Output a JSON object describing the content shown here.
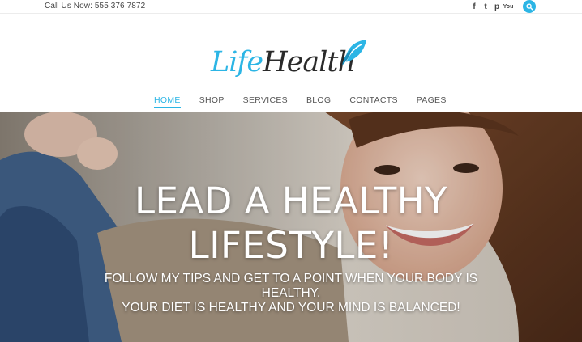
{
  "topbar": {
    "phone": "Call Us Now: 555 376 7872",
    "social": [
      {
        "name": "facebook-icon",
        "glyph": "f"
      },
      {
        "name": "twitter-icon",
        "glyph": "t"
      },
      {
        "name": "pinterest-icon",
        "glyph": "p"
      },
      {
        "name": "youtube-icon",
        "glyph": "You"
      }
    ],
    "search_icon": "search-icon"
  },
  "logo": {
    "part1": "Life",
    "part2": "Health",
    "icon": "butterfly-leaf-icon",
    "colors": {
      "accent": "#2cb5e5",
      "dark": "#2a2a2a"
    }
  },
  "nav": {
    "items": [
      "HOME",
      "SHOP",
      "SERVICES",
      "BLOG",
      "CONTACTS",
      "PAGES"
    ],
    "active": "HOME"
  },
  "hero": {
    "title_line1": "LEAD A HEALTHY",
    "title_line2": "LIFESTYLE!",
    "subtitle_line1": "FOLLOW MY TIPS AND GET TO A POINT WHEN YOUR BODY IS",
    "subtitle_line2": "HEALTHY,",
    "subtitle_line3": "YOUR DIET IS HEALTHY AND YOUR MIND IS BALANCED!"
  }
}
